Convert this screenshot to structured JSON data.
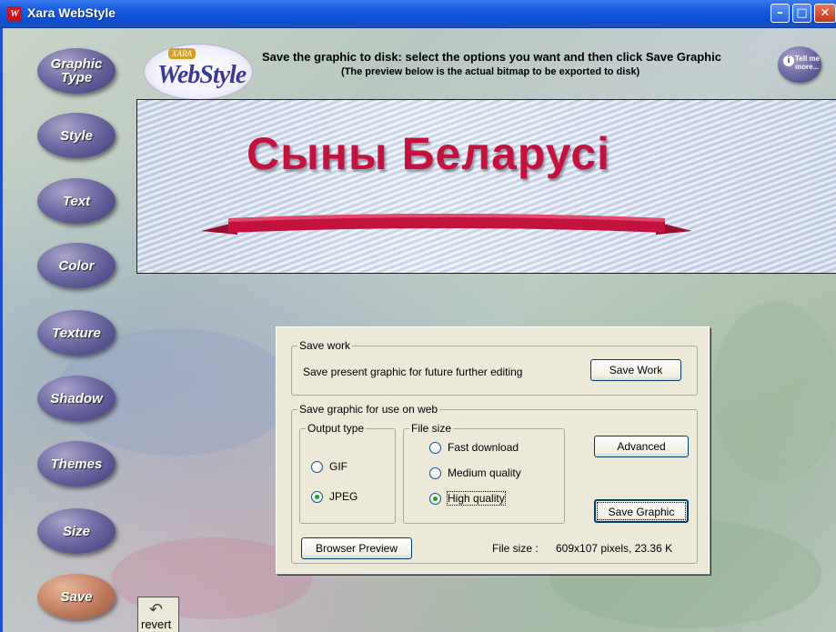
{
  "window": {
    "title": "Xara WebStyle",
    "logo_glyph": "W",
    "minimize_glyph": "–",
    "maximize_glyph": "□",
    "close_glyph": "✕"
  },
  "nav": {
    "items": [
      {
        "label": "Graphic Type",
        "active": false
      },
      {
        "label": "Style",
        "active": false
      },
      {
        "label": "Text",
        "active": false
      },
      {
        "label": "Color",
        "active": false
      },
      {
        "label": "Texture",
        "active": false
      },
      {
        "label": "Shadow",
        "active": false
      },
      {
        "label": "Themes",
        "active": false
      },
      {
        "label": "Size",
        "active": false
      },
      {
        "label": "Save",
        "active": true
      }
    ]
  },
  "header": {
    "logo_top": "XARA",
    "logo_main": "WebStyle",
    "instruction": "Save the graphic to disk: select the options you want and then click Save Graphic",
    "sub_instruction": "(The preview below is the actual bitmap to be exported to disk)",
    "tell_me_label": "Tell me more..."
  },
  "preview": {
    "banner_text": "Сыны Беларусі",
    "ribbon_color": "#c4123e"
  },
  "dialog": {
    "save_work": {
      "group_label": "Save work",
      "description": "Save present graphic for future further editing",
      "button_label": "Save Work"
    },
    "save_web": {
      "group_label": "Save graphic for use on web",
      "output_type": {
        "label": "Output type",
        "options": [
          {
            "label": "GIF",
            "checked": false
          },
          {
            "label": "JPEG",
            "checked": true
          }
        ]
      },
      "file_size": {
        "label": "File size",
        "options": [
          {
            "label": "Fast download",
            "checked": false
          },
          {
            "label": "Medium quality",
            "checked": false
          },
          {
            "label": "High quality",
            "checked": true
          }
        ]
      },
      "advanced_label": "Advanced",
      "save_graphic_label": "Save Graphic",
      "browser_preview_label": "Browser Preview",
      "file_size_label": "File size :",
      "file_size_value": "609x107 pixels, 23.36 K"
    }
  },
  "revert": {
    "label": "revert",
    "icon": "revert-arrow-icon"
  }
}
